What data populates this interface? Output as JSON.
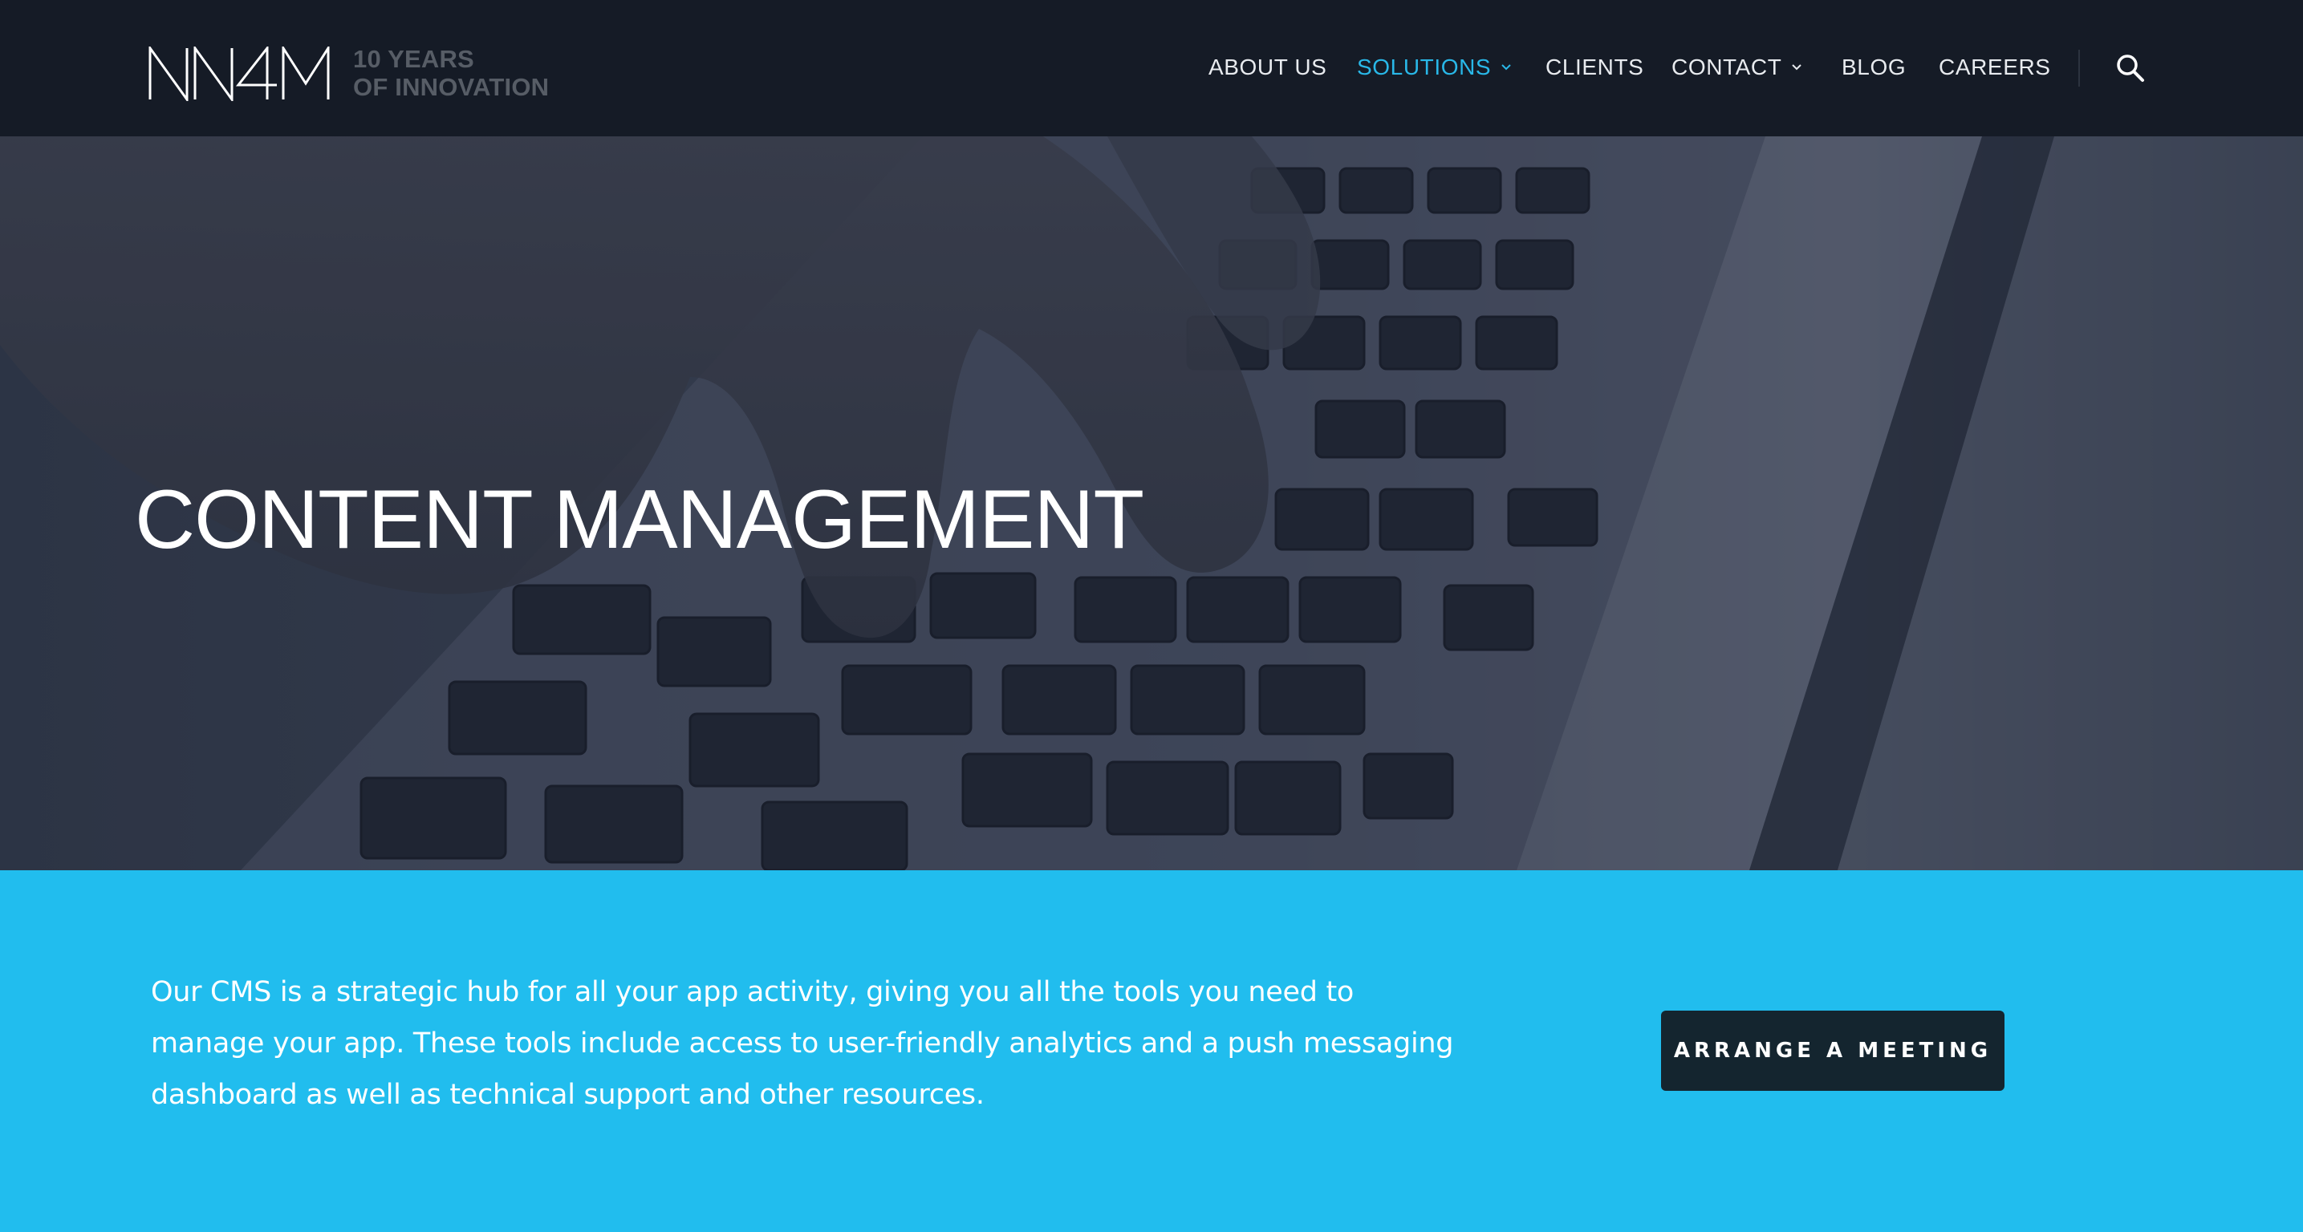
{
  "brand": {
    "logo_text": "NN4M",
    "tagline_line1": "10 YEARS",
    "tagline_line2": "OF INNOVATION"
  },
  "nav": {
    "items": [
      {
        "label": "ABOUT US",
        "active": false,
        "has_dropdown": false
      },
      {
        "label": "SOLUTIONS",
        "active": true,
        "has_dropdown": true
      },
      {
        "label": "CLIENTS",
        "active": false,
        "has_dropdown": false
      },
      {
        "label": "CONTACT",
        "active": false,
        "has_dropdown": true
      },
      {
        "label": "BLOG",
        "active": false,
        "has_dropdown": false
      },
      {
        "label": "CAREERS",
        "active": false,
        "has_dropdown": false
      }
    ],
    "search_icon": "search-icon"
  },
  "hero": {
    "title": "CONTENT MANAGEMENT",
    "background": "laptop-keyboard-photo"
  },
  "intro": {
    "text": "Our CMS is a strategic hub for all your app activity, giving you all the tools you need to manage your app. These tools include access to user-friendly analytics and a push messaging dashboard as well as technical support and other resources.",
    "cta_label": "ARRANGE A MEETING"
  },
  "colors": {
    "header_bg": "#151b26",
    "accent": "#29b8e8",
    "band_bg": "#21bdee",
    "cta_bg": "#14252f"
  }
}
